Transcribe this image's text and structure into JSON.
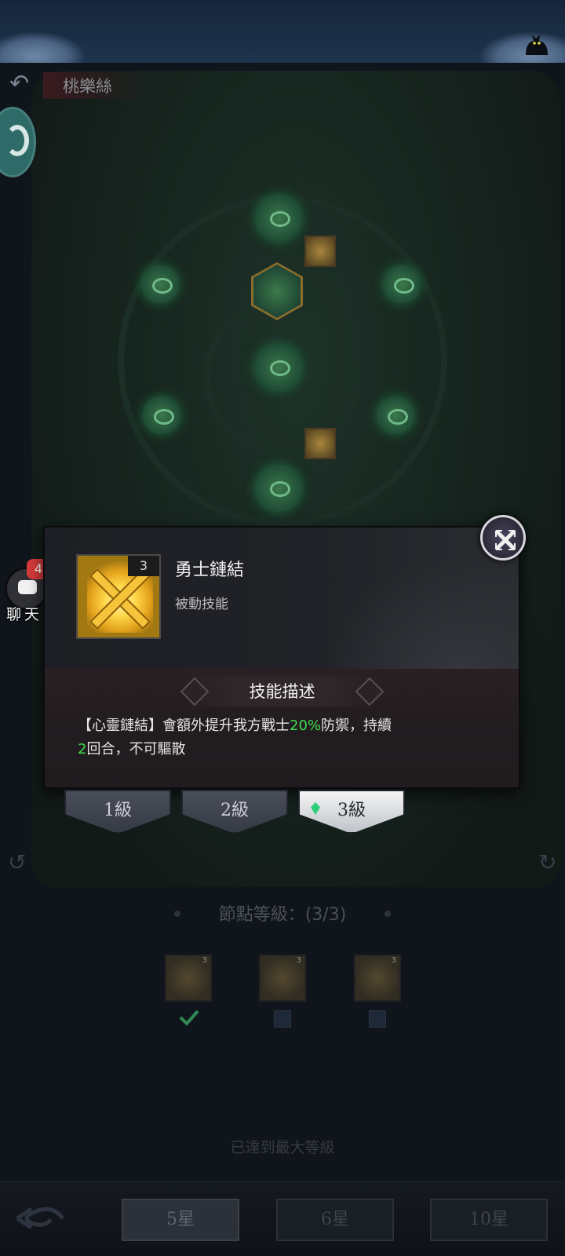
{
  "header": {
    "hero_name": "桃樂絲"
  },
  "chat": {
    "badge": "4",
    "label": "聊天"
  },
  "skill": {
    "name": "勇士鏈結",
    "type": "被動技能",
    "icon_level": "3",
    "description_title": "技能描述",
    "description": {
      "part1": "【心靈鏈結】會額外提升我方戰士",
      "value1": "20%",
      "part2": "防禦，持續",
      "value2": "2",
      "part3": "回合，不可驅散"
    }
  },
  "level_tabs": [
    {
      "label": "1級",
      "active": false
    },
    {
      "label": "2級",
      "active": false
    },
    {
      "label": "3級",
      "active": true
    }
  ],
  "node_level": "節點等級：(3/3)",
  "level_icons": [
    "3",
    "3",
    "3"
  ],
  "max_level_text": "已達到最大等級",
  "star_tabs": [
    {
      "label": "5星",
      "active": true
    },
    {
      "label": "6星",
      "active": false
    },
    {
      "label": "10星",
      "active": false
    }
  ],
  "colors": {
    "highlight": "#3fdd4f",
    "badge": "#d43a3a"
  }
}
